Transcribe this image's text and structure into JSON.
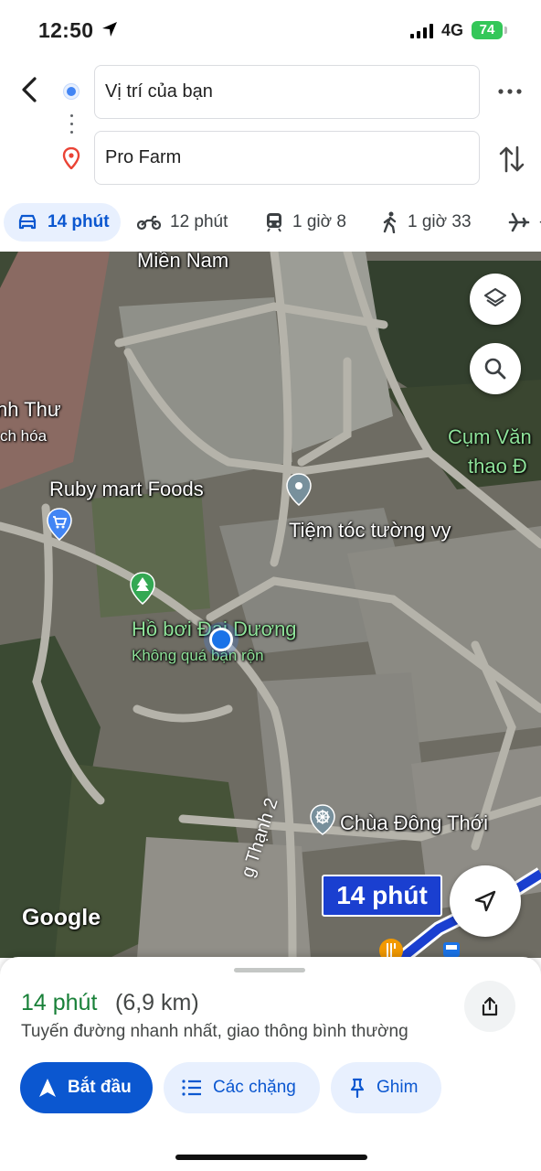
{
  "status_bar": {
    "time": "12:50",
    "network": "4G",
    "battery": "74"
  },
  "route": {
    "origin": "Vị trí của bạn",
    "destination": "Pro Farm"
  },
  "modes": {
    "drive": "14 phút",
    "motorbike": "12 phút",
    "transit": "1 giờ 8",
    "walk": "1 giờ 33",
    "flight": "-"
  },
  "map": {
    "labels": {
      "mien_nam": "Miền Nam",
      "thu": "nh Thư",
      "tap_hoa": "ch hóa",
      "ruby": "Ruby mart Foods",
      "tiem_toc": "Tiệm tóc tường vy",
      "ho_boi": "Hồ bơi Đại Dương",
      "khong_qua": "Không quá bận rộn",
      "chua": "Chùa Đông Thới",
      "cum_van": "Cụm Văn",
      "thao": "thao Đ",
      "road": "g Thạnh 2"
    },
    "google": "Google",
    "eta_badge": "14 phút"
  },
  "sheet": {
    "eta": "14 phút",
    "distance": "(6,9 km)",
    "description": "Tuyến đường nhanh nhất, giao thông bình thường",
    "start_label": "Bắt đầu",
    "stops_label": "Các chặng",
    "pin_label": "Ghim"
  },
  "colors": {
    "accent": "#0b57d0",
    "eta_green": "#188038",
    "route_blue": "#1a73e8",
    "battery": "#34c759"
  }
}
